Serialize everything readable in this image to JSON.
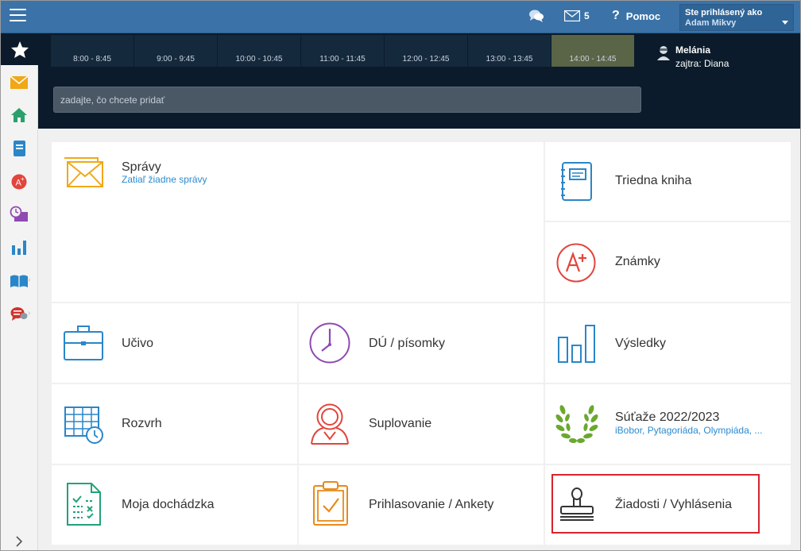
{
  "topbar": {
    "chat_icon": "chat-bubbles-icon",
    "mail_icon": "envelope-icon",
    "mail_count": "5",
    "help_label": "Pomoc",
    "user_label": "Ste prihlásený ako",
    "user_name": "Adam Mikvy"
  },
  "sidebar": {
    "items": [
      {
        "name": "star",
        "icon": "star-icon"
      },
      {
        "name": "mail",
        "icon": "envelope-icon",
        "color": "#f0a818"
      },
      {
        "name": "home",
        "icon": "home-icon",
        "color": "#2aa06c"
      },
      {
        "name": "notebook",
        "icon": "notebook-icon",
        "color": "#2a86c8"
      },
      {
        "name": "grades",
        "icon": "grade-icon",
        "color": "#e2453c"
      },
      {
        "name": "schedule",
        "icon": "clock-monitor-icon",
        "color": "#8e4ab2"
      },
      {
        "name": "results",
        "icon": "bar-chart-icon",
        "color": "#2a86c8"
      },
      {
        "name": "book",
        "icon": "open-book-icon",
        "color": "#2a86c8"
      },
      {
        "name": "discussion",
        "icon": "discussion-icon",
        "color": "#d0342c"
      }
    ]
  },
  "timeslots": [
    "8:00 - 8:45",
    "9:00 - 9:45",
    "10:00 - 10:45",
    "11:00 - 11:45",
    "12:00 - 12:45",
    "13:00 - 13:45",
    "14:00 - 14:45"
  ],
  "active_slot": "14:00 - 14:45",
  "teacher": {
    "name": "Melánia",
    "tomorrow": "zajtra: Diana"
  },
  "search": {
    "placeholder": "zadajte, čo chcete pridať"
  },
  "tiles": {
    "spravy": {
      "title": "Správy",
      "subtitle": "Zatiaľ žiadne správy",
      "icon": "envelope-icon",
      "color": "#f0a818"
    },
    "triedna_kniha": {
      "title": "Triedna kniha",
      "icon": "notebook-icon",
      "color": "#2a86c8"
    },
    "znamky": {
      "title": "Známky",
      "icon": "grade-a-plus-icon",
      "color": "#e2453c"
    },
    "ucivo": {
      "title": "Učivo",
      "icon": "briefcase-icon",
      "color": "#2a86c8"
    },
    "du": {
      "title": "DÚ / písomky",
      "icon": "clock-icon",
      "color": "#8e4ab2"
    },
    "vysledky": {
      "title": "Výsledky",
      "icon": "bar-chart-icon",
      "color": "#2a86c8"
    },
    "rozvrh": {
      "title": "Rozvrh",
      "icon": "timetable-icon",
      "color": "#2a86c8"
    },
    "suplovanie": {
      "title": "Suplovanie",
      "icon": "substitute-person-icon",
      "color": "#e2453c"
    },
    "sutaze": {
      "title": "Súťaže 2022/2023",
      "subtitle": "iBobor, Pytagoriáda, Olympiáda, ...",
      "icon": "laurel-wreath-icon",
      "color": "#6aa82e"
    },
    "dochadzka": {
      "title": "Moja dochádzka",
      "icon": "attendance-sheet-icon",
      "color": "#22a27a"
    },
    "prihlasovanie": {
      "title": "Prihlasovanie / Ankety",
      "icon": "clipboard-check-icon",
      "color": "#e88a1a"
    },
    "ziadosti": {
      "title": "Žiadosti / Vyhlásenia",
      "icon": "stamp-icon",
      "color": "#333333"
    }
  },
  "highlight_color": "#d6232e"
}
